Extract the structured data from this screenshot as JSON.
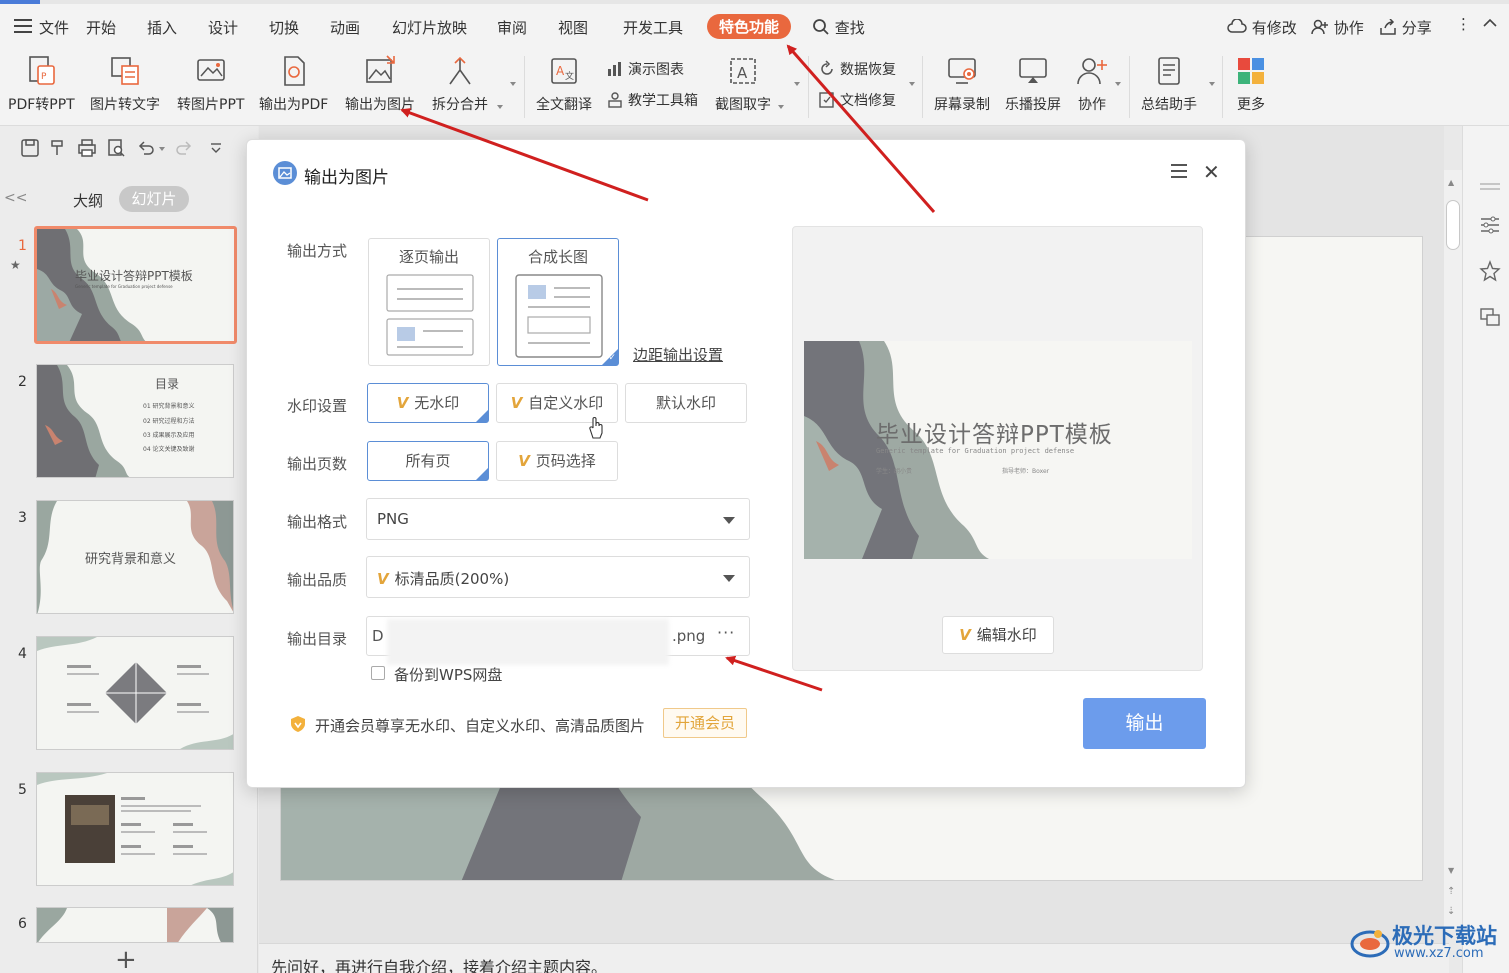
{
  "menubar": {
    "items": [
      "文件",
      "开始",
      "插入",
      "设计",
      "切换",
      "动画",
      "幻灯片放映",
      "审阅",
      "视图",
      "开发工具",
      "特色功能"
    ],
    "search": "查找",
    "right": [
      "有修改",
      "协作",
      "分享"
    ]
  },
  "ribbon": {
    "big": [
      "PDF转PPT",
      "图片转文字",
      "转图片PPT",
      "输出为PDF",
      "输出为图片",
      "拆分合并",
      "全文翻译",
      "截图取字",
      "屏幕录制",
      "乐播投屏",
      "协作",
      "总结助手",
      "更多"
    ],
    "small": [
      "演示图表",
      "教学工具箱",
      "数据恢复",
      "文档修复"
    ]
  },
  "left_panel": {
    "tab_outline": "大纲",
    "tab_slides": "幻灯片",
    "slides": [
      {
        "num": "1",
        "title": "毕业设计答辩PPT模板",
        "sub": "Generic template for Graduation project defense"
      },
      {
        "num": "2",
        "title": "目录",
        "items": [
          "01  研究背景和意义",
          "02  研究过程和方法",
          "03  成果展示及应用",
          "04  论文关键及致谢"
        ]
      },
      {
        "num": "3",
        "title": "研究背景和意义"
      },
      {
        "num": "4"
      },
      {
        "num": "5"
      },
      {
        "num": "6"
      }
    ]
  },
  "notes": "先问好，再进行自我介绍，接着介绍主题内容。",
  "dialog": {
    "title": "输出为图片",
    "labels": {
      "mode": "输出方式",
      "watermark": "水印设置",
      "pages": "输出页数",
      "format": "输出格式",
      "quality": "输出品质",
      "dir": "输出目录"
    },
    "mode_options": [
      "逐页输出",
      "合成长图"
    ],
    "margin_link": "边距输出设置",
    "watermark_options": [
      "无水印",
      "自定义水印",
      "默认水印"
    ],
    "page_options": [
      "所有页",
      "页码选择"
    ],
    "format_value": "PNG",
    "quality_value": "标清品质(200%)",
    "dir_value_start": "D",
    "dir_value_end": ".png",
    "dir_more": "···",
    "backup_label": "备份到WPS网盘",
    "vip_text": "开通会员尊享无水印、自定义水印、高清品质图片",
    "vip_button": "开通会员",
    "export_button": "输出",
    "preview": {
      "title": "毕业设计答辩PPT模板",
      "sub": "Generic template for Graduation project defense",
      "student": "学生：胡小贵",
      "teacher": "指导老师：Boxer",
      "edit_watermark": "编辑水印"
    }
  },
  "logo": {
    "name": "极光下载站",
    "url": "www.xz7.com"
  },
  "colors": {
    "accent": "#e9683e",
    "primary": "#6c9cec",
    "selected_border": "#5b8ed6",
    "vip": "#e2a53b",
    "arrow": "#d0201f"
  }
}
